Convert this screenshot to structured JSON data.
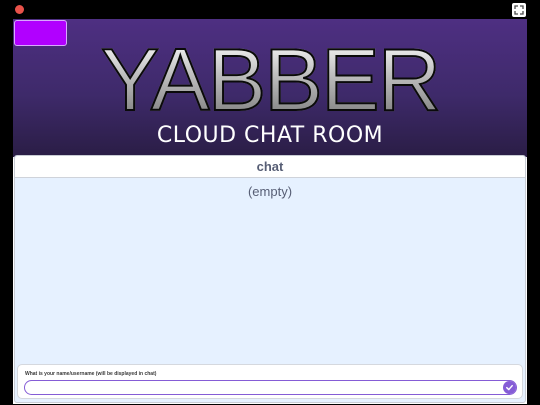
{
  "window": {
    "close_icon": "red-dot-icon",
    "fullscreen_icon": "fullscreen-icon"
  },
  "banner": {
    "title": "YABBER",
    "subtitle": "CLOUD CHAT ROOM",
    "accent_color": "#b100ff",
    "background_color": "#3e2a6a"
  },
  "chat": {
    "header": "chat",
    "empty_text": "(empty)"
  },
  "ask": {
    "prompt": "What is your name/username (will be displayed in chat)",
    "value": "",
    "submit_icon": "checkmark-icon",
    "accent_color": "#855cd6"
  }
}
